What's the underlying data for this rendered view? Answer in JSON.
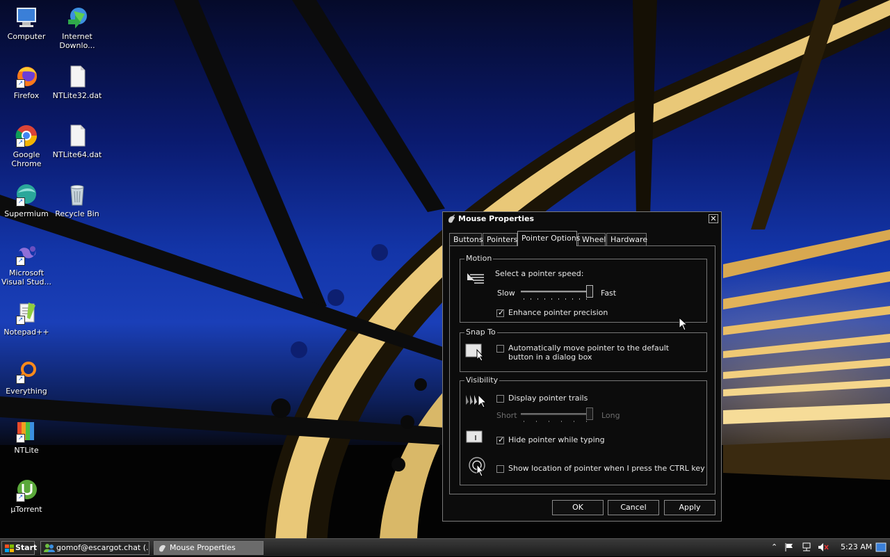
{
  "desktop": {
    "icons": [
      {
        "label": "Computer",
        "icon": "computer-icon"
      },
      {
        "label": "Internet Downlo...",
        "icon": "internet-download-manager-icon"
      },
      {
        "label": "Firefox",
        "icon": "firefox-icon"
      },
      {
        "label": "NTLite32.dat",
        "icon": "file-icon"
      },
      {
        "label": "Google Chrome",
        "icon": "chrome-icon"
      },
      {
        "label": "NTLite64.dat",
        "icon": "file-icon"
      },
      {
        "label": "Supermium",
        "icon": "supermium-icon"
      },
      {
        "label": "Recycle Bin",
        "icon": "recycle-bin-icon"
      },
      {
        "label": "Microsoft Visual Stud...",
        "icon": "visual-studio-icon"
      },
      {
        "label": "Notepad++",
        "icon": "notepad-plus-plus-icon"
      },
      {
        "label": "Everything",
        "icon": "everything-search-icon"
      },
      {
        "label": "NTLite",
        "icon": "ntlite-icon"
      },
      {
        "label": "µTorrent",
        "icon": "utorrent-icon"
      }
    ]
  },
  "dialog": {
    "title": "Mouse Properties",
    "close": "✕",
    "tabs": [
      {
        "label": "Buttons",
        "active": false
      },
      {
        "label": "Pointers",
        "active": false
      },
      {
        "label": "Pointer Options",
        "active": true
      },
      {
        "label": "Wheel",
        "active": false
      },
      {
        "label": "Hardware",
        "active": false
      }
    ],
    "motion": {
      "group_label": "Motion",
      "speed_label": "Select a pointer speed:",
      "slow": "Slow",
      "fast": "Fast",
      "speed_level": 1.0,
      "enhance_label": "Enhance pointer precision",
      "enhance_checked": true
    },
    "snap_to": {
      "group_label": "Snap To",
      "auto_label": "Automatically move pointer to the default button in a dialog box",
      "auto_checked": false
    },
    "visibility": {
      "group_label": "Visibility",
      "trails_label": "Display pointer trails",
      "trails_checked": false,
      "short": "Short",
      "long": "Long",
      "trails_level": 1.0,
      "hide_label": "Hide pointer while typing",
      "hide_checked": true,
      "ctrl_label": "Show location of pointer when I press the CTRL key",
      "ctrl_checked": false
    },
    "buttons": {
      "ok": "OK",
      "cancel": "Cancel",
      "apply": "Apply"
    }
  },
  "taskbar": {
    "start_label": "Start",
    "tasks": [
      {
        "label": "gomof@escargot.chat (...",
        "active": false
      },
      {
        "label": "Mouse Properties",
        "active": true
      }
    ],
    "clock": "5:23 AM",
    "tray_icons": [
      "show-hidden-icons-icon",
      "action-center-flag-icon",
      "network-icon",
      "volume-muted-icon",
      "show-desktop-icon"
    ]
  },
  "colors": {
    "dialog_bg": "#0c0c0c",
    "border": "#777777",
    "active_task": "#6b6b6b"
  }
}
